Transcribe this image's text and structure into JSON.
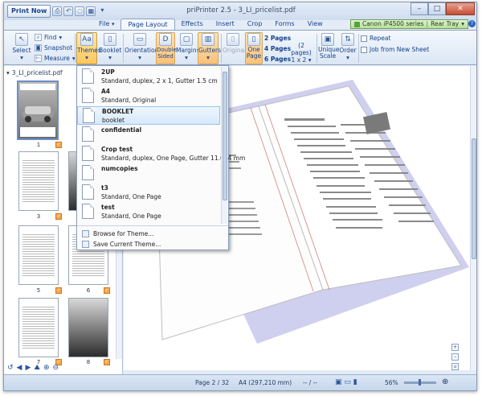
{
  "app": {
    "title": "priPrinter 2.5 - 3_LI_pricelist.pdf",
    "print_now": "Print Now"
  },
  "tabs": [
    {
      "label": "File"
    },
    {
      "label": "Page Layout"
    },
    {
      "label": "Effects"
    },
    {
      "label": "Insert"
    },
    {
      "label": "Crop"
    },
    {
      "label": "Forms"
    },
    {
      "label": "View"
    }
  ],
  "printer": {
    "name": "Canon iP4500 series",
    "tray": "Rear Tray"
  },
  "ribbon": {
    "select": "Select",
    "find": "Find",
    "snapshot": "Snapshot",
    "measure": "Measure",
    "themes": "Themes",
    "booklet": "Booklet",
    "orientation": "Orientation",
    "double_sided": "Double Sided",
    "margins": "Margins",
    "gutters": "Gutters",
    "original": "Original",
    "one_page": "One Page",
    "two_pages": "2 Pages",
    "four_pages": "4 Pages",
    "six_pages": "6 Pages",
    "pages_2_label": "(2 pages)",
    "layout_1x2": "1 x 2",
    "unique_scale": "Unique Scale",
    "order": "Order",
    "repeat": "Repeat",
    "job_from_new_sheet": "Job from New Sheet"
  },
  "left_panel": {
    "file": "3_LI_pricelist.pdf",
    "pages": [
      "1",
      "3",
      "5",
      "6",
      "7",
      "8"
    ]
  },
  "themes_menu": {
    "items": [
      {
        "name": "2UP",
        "desc": "Standard, duplex, 2 x 1, Gutter 1.5 cm"
      },
      {
        "name": "A4",
        "desc": "Standard, Original"
      },
      {
        "name": "BOOKLET",
        "desc": "booklet"
      },
      {
        "name": "confidential",
        "desc": ""
      },
      {
        "name": "Crop test",
        "desc": "Standard, duplex, One Page, Gutter 11.664 mm"
      },
      {
        "name": "numcopies",
        "desc": ""
      },
      {
        "name": "t3",
        "desc": "Standard, One Page"
      },
      {
        "name": "test",
        "desc": "Standard, One Page"
      }
    ],
    "browse": "Browse for Theme...",
    "save": "Save Current Theme..."
  },
  "status": {
    "page": "Page 2 / 32",
    "paper": "A4 (297,210 mm)",
    "range": "-- / --",
    "zoom": "56%"
  },
  "colors": {
    "accent": "#ffc75d",
    "ribbon": "#dbe6f4",
    "shadow_page": "#c8c8ea"
  }
}
